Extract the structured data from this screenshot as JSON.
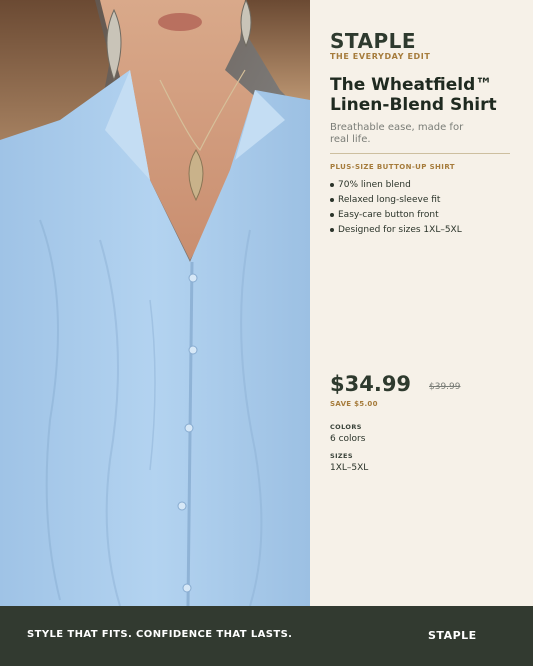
{
  "brand": "STAPLE",
  "eyebrow": "THE EVERYDAY EDIT",
  "product": {
    "title_line1": "The Wheatfield™",
    "title_line2": "Linen-Blend Shirt",
    "tagline": "Breathable ease, made for real life.",
    "category": "PLUS-SIZE BUTTON-UP SHIRT",
    "features": [
      "70% linen blend",
      "Relaxed long-sleeve fit",
      "Easy-care button front",
      "Designed for sizes 1XL–5XL"
    ]
  },
  "pricing": {
    "price": "$34.99",
    "old_price": "$39.99",
    "save": "SAVE $5.00"
  },
  "specs": {
    "colors_label": "COLORS",
    "colors_value": "6 colors",
    "sizes_label": "SIZES",
    "sizes_value": "1XL–5XL"
  },
  "footer": {
    "slogan": "STYLE THAT FITS. CONFIDENCE THAT LASTS.",
    "brand": "STAPLE"
  },
  "colors": {
    "shirt": "#a9cbea",
    "panel_bg": "#f6f1e8",
    "footer_bg": "#323a30",
    "accent_gold": "#a67c3c",
    "brand_dark": "#2e3a2e"
  }
}
